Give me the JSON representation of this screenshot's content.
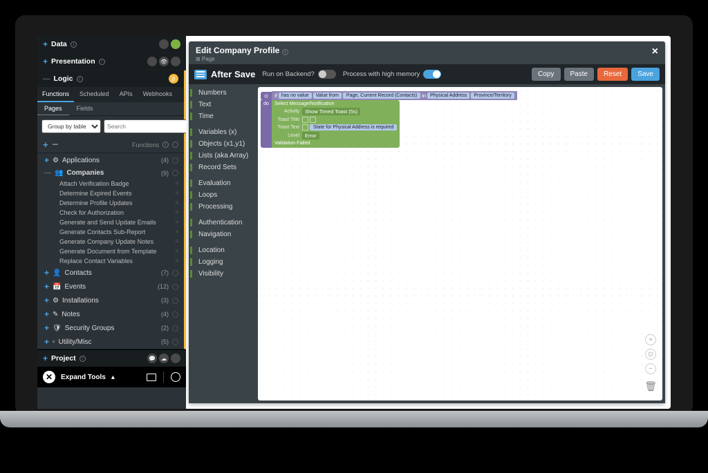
{
  "sidebar": {
    "sections": {
      "data": "Data",
      "presentation": "Presentation",
      "logic": "Logic",
      "project": "Project"
    },
    "tabs": [
      "Functions",
      "Scheduled",
      "APIs",
      "Webhooks"
    ],
    "subtabs": [
      "Pages",
      "Fields"
    ],
    "groupBy": "Group by table",
    "searchPlaceholder": "Search",
    "functionsLabel": "Functions",
    "tree": [
      {
        "icon": "sliders",
        "label": "Applications",
        "count": "(4)"
      },
      {
        "icon": "users",
        "label": "Companies",
        "count": "(9)",
        "expanded": true,
        "children": [
          "Attach Verification Badge",
          "Determine Expired Events",
          "Determine Profile Updates",
          "Check for Authorization",
          "Generate and Send Update Emails",
          "Generate Contacts Sub-Report",
          "Generate Company Update Notes",
          "Generate Document from Template",
          "Replace Contact Variables"
        ]
      },
      {
        "icon": "user",
        "label": "Contacts",
        "count": "(7)"
      },
      {
        "icon": "calendar",
        "label": "Events",
        "count": "(12)"
      },
      {
        "icon": "gear",
        "label": "Installations",
        "count": "(3)"
      },
      {
        "icon": "edit",
        "label": "Notes",
        "count": "(4)"
      },
      {
        "icon": "shield",
        "label": "Security Groups",
        "count": "(2)"
      },
      {
        "icon": "blank",
        "label": "Utility/Misc",
        "count": "(5)"
      }
    ],
    "expand": "Expand Tools"
  },
  "editor": {
    "title": "Edit Company Profile",
    "subtitle": "⊞ Page",
    "section": "After Save",
    "options": {
      "backend": "Run on Backend?",
      "highmem": "Process with high memory"
    },
    "buttons": {
      "copy": "Copy",
      "paste": "Paste",
      "reset": "Reset",
      "save": "Save"
    },
    "palette": [
      {
        "group": [
          "Numbers",
          "Text",
          "Time"
        ]
      },
      {
        "group": [
          "Variables (x)",
          "Objects (x1,y1)",
          "Lists (aka Array)",
          "Record Sets"
        ]
      },
      {
        "group": [
          "Evaluation",
          "Loops",
          "Processing"
        ]
      },
      {
        "group": [
          "Authentication",
          "Navigation"
        ]
      },
      {
        "group": [
          "Location",
          "Logging",
          "Visibility"
        ]
      }
    ],
    "blocks": {
      "if": "if",
      "hasNoValue": "has no value",
      "valueFrom": "Value from",
      "page": "Page, Current Record (Contacts)",
      "in": "in",
      "physical": "Physical Address",
      "province": "Province/Territory",
      "do": "do",
      "select": "Select Message/Notification",
      "activity": "Activity",
      "showToast": "Show Timed Toast (5s)",
      "toastTitle": "Toast Title",
      "toastText": "Toast Text",
      "toastMsg": "State for Physical Address is required",
      "level": "Level",
      "error": "Error",
      "validation": "Validation Failed"
    }
  }
}
